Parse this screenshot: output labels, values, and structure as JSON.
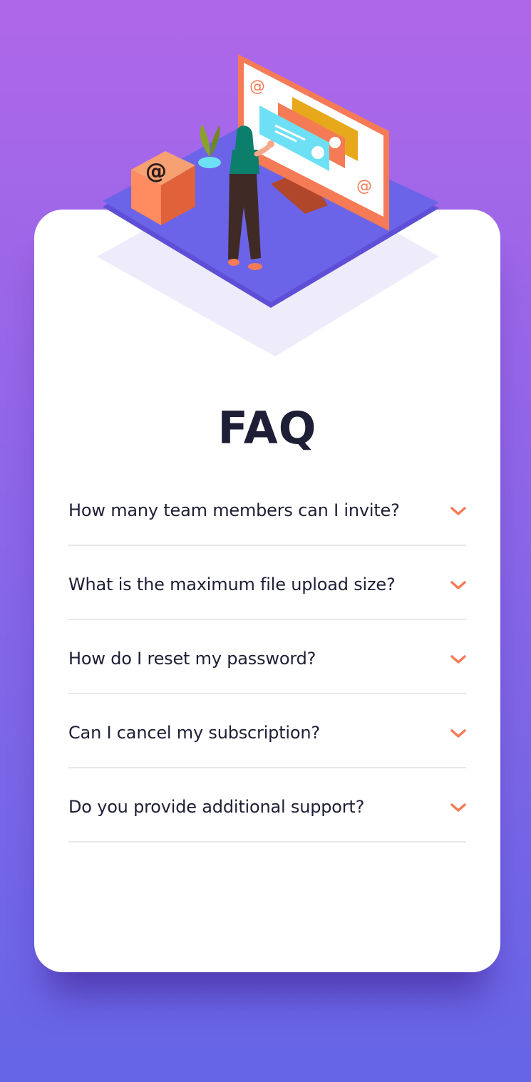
{
  "page": {
    "title": "FAQ"
  },
  "colors": {
    "background_top": "#af67e9",
    "background_bottom": "#6565e7",
    "card": "#ffffff",
    "heading": "#1e1f36",
    "accent": "#f47b56",
    "divider": "#e7e7e9"
  },
  "illustration": {
    "icon": "woman-at-monitor-illustration"
  },
  "faq": {
    "items": [
      {
        "question": "How many team members can I invite?",
        "icon": "chevron-down-icon"
      },
      {
        "question": "What is the maximum file upload size?",
        "icon": "chevron-down-icon"
      },
      {
        "question": "How do I reset my password?",
        "icon": "chevron-down-icon"
      },
      {
        "question": "Can I cancel my subscription?",
        "icon": "chevron-down-icon"
      },
      {
        "question": "Do you provide additional support?",
        "icon": "chevron-down-icon"
      }
    ]
  }
}
